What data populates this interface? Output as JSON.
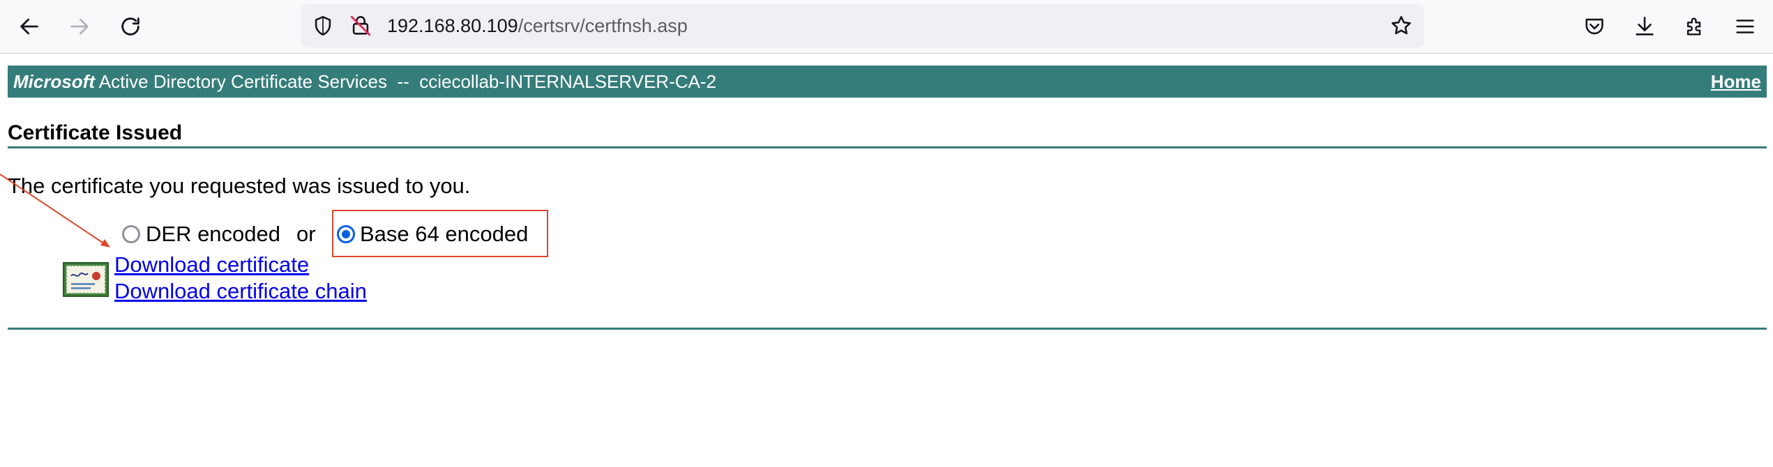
{
  "browser": {
    "url_host": "192.168.80.109",
    "url_path": "/certsrv/certfnsh.asp",
    "icons": {
      "back": "back-arrow-icon",
      "forward": "forward-arrow-icon",
      "reload": "reload-icon",
      "shield": "shield-icon",
      "insecure": "insecure-lock-icon",
      "bookmark": "bookmark-star-icon",
      "pocket": "pocket-icon",
      "downloads": "download-icon",
      "extensions": "extensions-icon",
      "menu": "hamburger-menu-icon"
    }
  },
  "banner": {
    "brand": "Microsoft",
    "service": " Active Directory Certificate Services  --  cciecollab-INTERNALSERVER-CA-2",
    "home": "Home"
  },
  "page": {
    "title": "Certificate Issued",
    "message": "The certificate you requested was issued to you.",
    "encoding": {
      "der_label": "DER encoded",
      "or_text": "or",
      "base64_label": "Base 64 encoded",
      "selected": "base64"
    },
    "links": {
      "download_certificate": "Download certificate",
      "download_chain": "Download certificate chain"
    }
  },
  "colors": {
    "banner_bg": "#357d7b",
    "annotation": "#e0452a",
    "link": "#0000ee"
  }
}
